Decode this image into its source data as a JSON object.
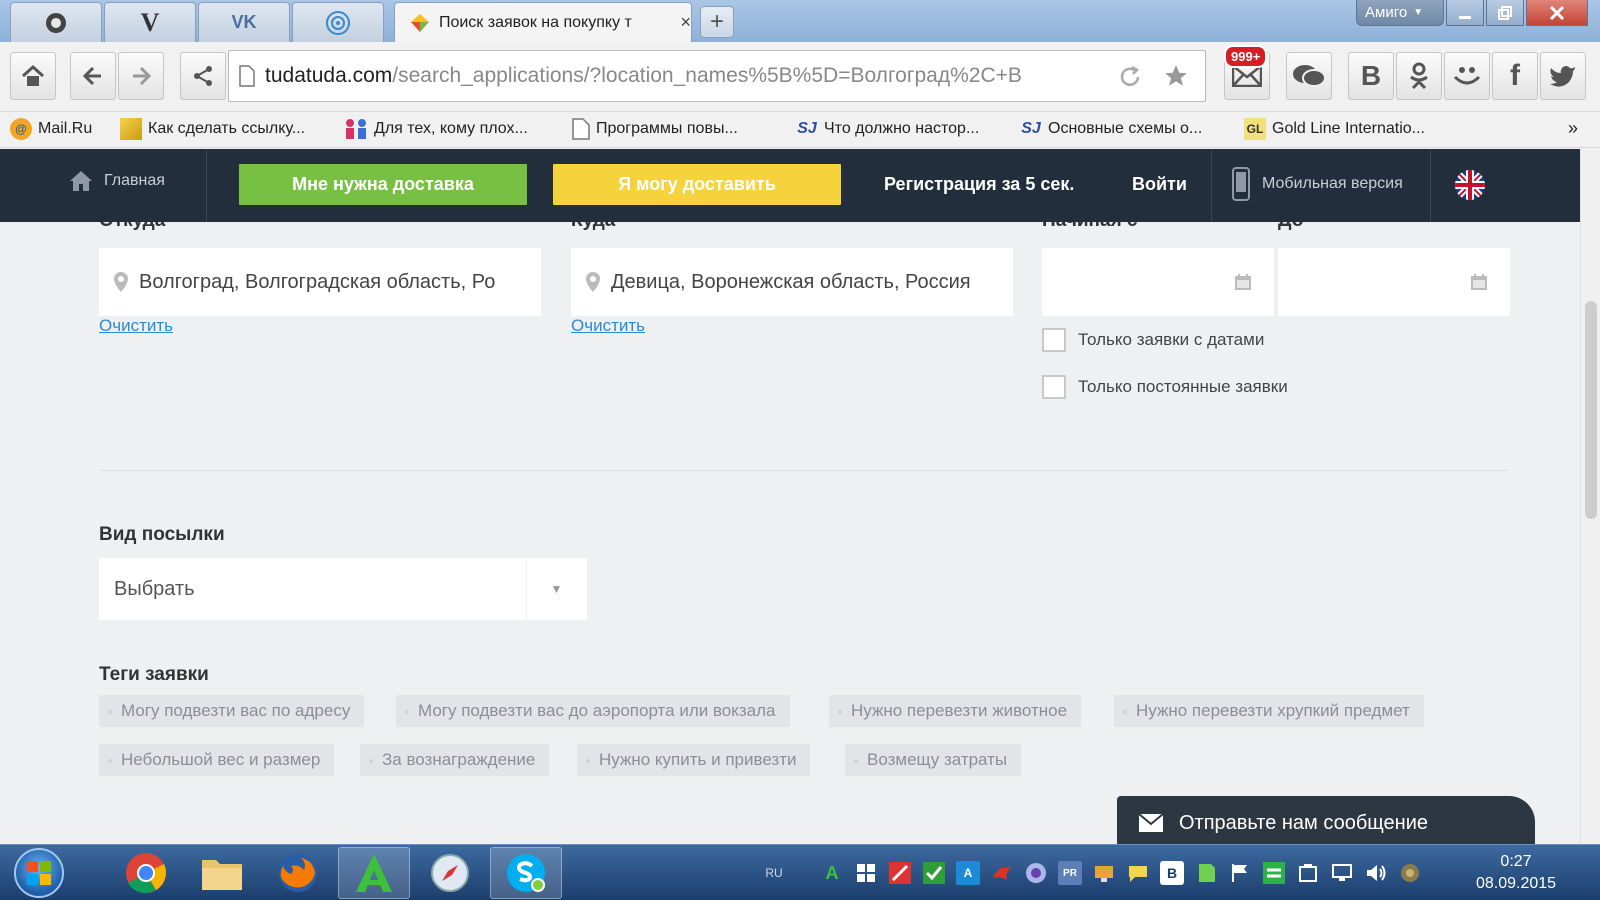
{
  "browser": {
    "tabs": [
      {
        "id": "pinned-1",
        "label": ""
      },
      {
        "id": "pinned-2",
        "label": "V"
      },
      {
        "id": "pinned-3",
        "label": "VK"
      },
      {
        "id": "pinned-4",
        "label": ""
      }
    ],
    "active_tab": {
      "title": "Поиск заявок на покупку т",
      "close": "×"
    },
    "new_tab": "+",
    "profile_button": "Амиго",
    "url": {
      "domain": "tudatuda.com",
      "path": "/search_applications/?location_names%5B%5D=Волгоград%2C+В"
    },
    "mail_badge": "999+",
    "social_letters": {
      "vk": "B",
      "fb": "f"
    },
    "bookmarks": [
      {
        "label": "Mail.Ru"
      },
      {
        "label": "Как сделать ссылку..."
      },
      {
        "label": "Для тех, кому плох..."
      },
      {
        "label": "Программы повы..."
      },
      {
        "label": "Что должно настор..."
      },
      {
        "label": "Основные схемы о..."
      },
      {
        "label": "Gold Line Internatio..."
      }
    ],
    "bookmarks_more": "»"
  },
  "site_nav": {
    "home": "Главная",
    "need_delivery": "Мне нужна доставка",
    "can_deliver": "Я могу доставить",
    "register": "Регистрация за 5 сек.",
    "login": "Войти",
    "mobile": "Мобильная версия"
  },
  "form": {
    "from": {
      "label": "Откуда",
      "value": "Волгоград, Волгоградская область, Ро",
      "clear": "Очистить"
    },
    "to": {
      "label": "Куда",
      "value": "Девица, Воронежская область, Россия",
      "clear": "Очистить"
    },
    "date_from": {
      "label": "Начиная с"
    },
    "date_to": {
      "label": "До"
    },
    "only_dated": "Только заявки с датами",
    "only_permanent": "Только постоянные заявки",
    "parcel_type": {
      "label": "Вид посылки",
      "value": "Выбрать"
    },
    "tags_label": "Теги заявки",
    "tags": [
      "Могу подвезти вас по адресу",
      "Могу подвезти вас до аэропорта или вокзала",
      "Нужно перевезти животное",
      "Нужно перевезти хрупкий предмет",
      "Небольшой вес и размер",
      "За вознаграждение",
      "Нужно купить и привезти",
      "Возмещу затраты"
    ]
  },
  "message_widget": "Отправьте нам сообщение",
  "taskbar": {
    "lang": "RU",
    "time": "0:27",
    "date": "08.09.2015"
  },
  "colors": {
    "nav_bg": "#232e3c",
    "need_btn": "#77c043",
    "can_btn": "#f6d33c",
    "link": "#2a8ad6"
  }
}
